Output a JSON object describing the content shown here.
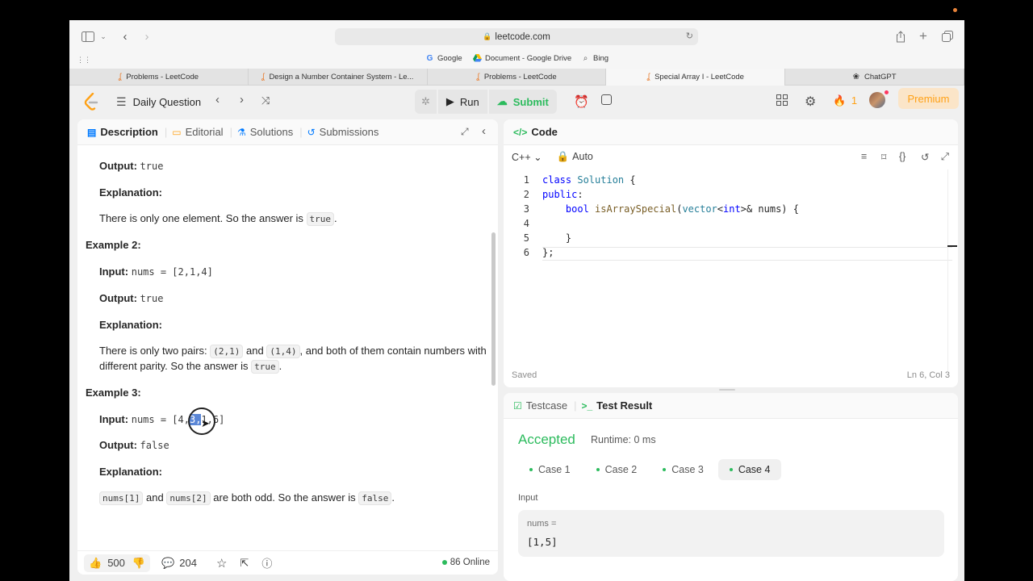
{
  "browser": {
    "url": "leetcode.com",
    "favorites": [
      "Google",
      "Document - Google Drive",
      "Bing"
    ],
    "tabs": [
      "Problems - LeetCode",
      "Design a Number Container System - Le...",
      "Problems - LeetCode",
      "Special Array I - LeetCode",
      "ChatGPT"
    ],
    "active_tab": 3
  },
  "nav": {
    "list_label": "Daily Question",
    "run_label": "Run",
    "submit_label": "Submit",
    "streak_count": "1",
    "premium_label": "Premium"
  },
  "description": {
    "tabs": [
      "Description",
      "Editorial",
      "Solutions",
      "Submissions"
    ],
    "output_label": "Output:",
    "input_label": "Input:",
    "explanation_label": "Explanation:",
    "ex1_output": "true",
    "ex1_expl_text": "There is only one element. So the answer is",
    "ex1_expl_code": "true",
    "ex2_title": "Example 2:",
    "ex2_input": "nums = [2,1,4]",
    "ex2_output": "true",
    "ex2_expl_1": "There is only two pairs:",
    "ex2_expl_code1": "(2,1)",
    "ex2_expl_and": "and",
    "ex2_expl_code2": "(1,4)",
    "ex2_expl_2": ", and both of them contain numbers with",
    "ex2_expl_3": "different parity. So the answer is",
    "ex2_expl_code3": "true",
    "ex3_title": "Example 3:",
    "ex3_input_pre": "nums = [4,",
    "ex3_input_hl": "3,",
    "ex3_input_post": "1,6]",
    "ex3_output": "false",
    "ex3_code1": "nums[1]",
    "ex3_and": "and",
    "ex3_code2": "nums[2]",
    "ex3_text": "are both odd. So the answer is",
    "ex3_code3": "false",
    "likes": "500",
    "comments": "204",
    "online": "86 Online"
  },
  "code": {
    "header": "Code",
    "language": "C++",
    "mode": "Auto",
    "lines": [
      {
        "n": "1",
        "t": "class Solution {"
      },
      {
        "n": "2",
        "t": "public:"
      },
      {
        "n": "3",
        "t": "    bool isArraySpecial(vector<int>& nums) {"
      },
      {
        "n": "4",
        "t": "        "
      },
      {
        "n": "5",
        "t": "    }"
      },
      {
        "n": "6",
        "t": "};"
      }
    ],
    "saved": "Saved",
    "position": "Ln 6, Col 3"
  },
  "result": {
    "tabs": [
      "Testcase",
      "Test Result"
    ],
    "status": "Accepted",
    "runtime": "Runtime: 0 ms",
    "cases": [
      "Case 1",
      "Case 2",
      "Case 3",
      "Case 4"
    ],
    "active_case": 3,
    "input_label": "Input",
    "var_label": "nums =",
    "var_value": "[1,5]"
  },
  "colors": {
    "accent_green": "#2cbb5d",
    "brand_orange": "#ffa116"
  }
}
